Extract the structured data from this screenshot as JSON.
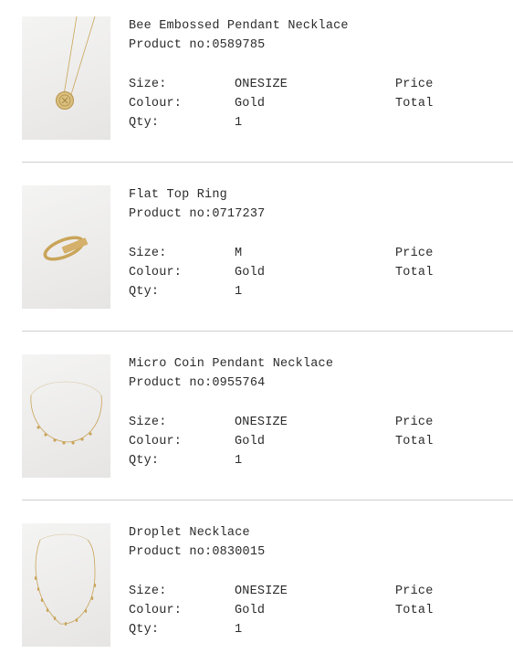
{
  "labels": {
    "product_no": "Product no:",
    "size": "Size:",
    "colour": "Colour:",
    "qty": "Qty:",
    "price": "Price",
    "total": "Total"
  },
  "items": [
    {
      "name": "Bee Embossed Pendant Necklace",
      "product_no": "0589785",
      "size": "ONESIZE",
      "colour": "Gold",
      "qty": "1",
      "image": "coin-pendant-necklace-image"
    },
    {
      "name": "Flat Top Ring",
      "product_no": "0717237",
      "size": "M",
      "colour": "Gold",
      "qty": "1",
      "image": "gold-ring-image"
    },
    {
      "name": "Micro Coin Pendant Necklace",
      "product_no": "0955764",
      "size": "ONESIZE",
      "colour": "Gold",
      "qty": "1",
      "image": "micro-coin-necklace-image"
    },
    {
      "name": "Droplet Necklace",
      "product_no": "0830015",
      "size": "ONESIZE",
      "colour": "Gold",
      "qty": "1",
      "image": "droplet-necklace-image"
    }
  ],
  "colors": {
    "text": "#2b2b2b",
    "divider": "#cfcfcf",
    "gold": "#c9a55a"
  }
}
